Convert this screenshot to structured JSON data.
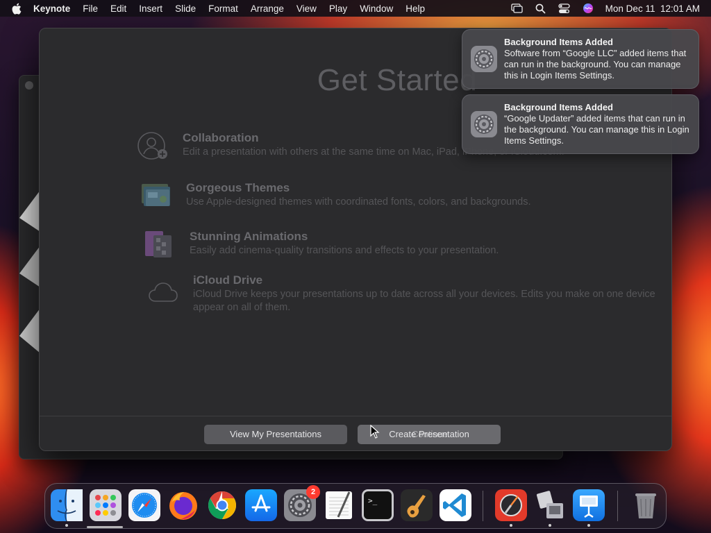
{
  "menubar": {
    "app_name": "Keynote",
    "items": [
      "File",
      "Edit",
      "Insert",
      "Slide",
      "Format",
      "Arrange",
      "View",
      "Play",
      "Window",
      "Help"
    ],
    "clock": "Mon Dec 11  12:01 AM",
    "status_icons": [
      "screen-mirroring-icon",
      "spotlight-search-icon",
      "control-center-icon",
      "siri-icon"
    ]
  },
  "welcome": {
    "title": "Get Started",
    "features": [
      {
        "icon": "collaboration-icon",
        "title": "Collaboration",
        "desc": "Edit a presentation with others at the same time on Mac, iPad, iPhone, or iCloud.com."
      },
      {
        "icon": "themes-icon",
        "title": "Gorgeous Themes",
        "desc": "Use Apple-designed themes with coordinated fonts, colors, and backgrounds."
      },
      {
        "icon": "animations-icon",
        "title": "Stunning Animations",
        "desc": "Easily add cinema-quality transitions and effects to your presentation."
      },
      {
        "icon": "icloud-icon",
        "title": "iCloud Drive",
        "desc": "iCloud Drive keeps your presentations up to date across all your devices. Edits you make on one device appear on all of them."
      }
    ],
    "buttons": {
      "view": "View My Presentations",
      "create": "Create Presentation",
      "continue_overlay": "Continue"
    }
  },
  "notifications": [
    {
      "icon": "system-settings-icon",
      "title": "Background Items Added",
      "body": "Software from “Google LLC” added items that can run in the background. You can manage this in Login Items Settings."
    },
    {
      "icon": "system-settings-icon",
      "title": "Background Items Added",
      "body": "“Google Updater” added items that can run in the background. You can manage this in Login Items Settings."
    }
  ],
  "dock": {
    "apps": [
      {
        "name": "Finder",
        "icon": "finder-icon",
        "running": true
      },
      {
        "name": "Launchpad",
        "icon": "launchpad-icon",
        "running": false
      },
      {
        "name": "Safari",
        "icon": "safari-icon",
        "running": false
      },
      {
        "name": "Firefox",
        "icon": "firefox-icon",
        "running": false
      },
      {
        "name": "Google Chrome",
        "icon": "chrome-icon",
        "running": false
      },
      {
        "name": "App Store",
        "icon": "app-store-icon",
        "running": false
      },
      {
        "name": "System Settings",
        "icon": "system-settings-icon",
        "running": false,
        "badge": "2"
      },
      {
        "name": "TextEdit",
        "icon": "textedit-icon",
        "running": false
      },
      {
        "name": "Terminal",
        "icon": "terminal-icon",
        "running": false
      },
      {
        "name": "GarageBand",
        "icon": "garageband-icon",
        "running": false
      },
      {
        "name": "Visual Studio Code",
        "icon": "vscode-icon",
        "running": false
      },
      {
        "name": "Instruments",
        "icon": "instruments-icon",
        "running": true
      },
      {
        "name": "Migration Assistant",
        "icon": "migration-assistant-icon",
        "running": true
      },
      {
        "name": "Keynote",
        "icon": "keynote-icon",
        "running": true
      },
      {
        "name": "Trash",
        "icon": "trash-icon",
        "running": false
      }
    ]
  },
  "colors": {
    "notification_bg": "#48484c",
    "badge": "#ff3b30",
    "window_bg": "#2b2b2d"
  }
}
